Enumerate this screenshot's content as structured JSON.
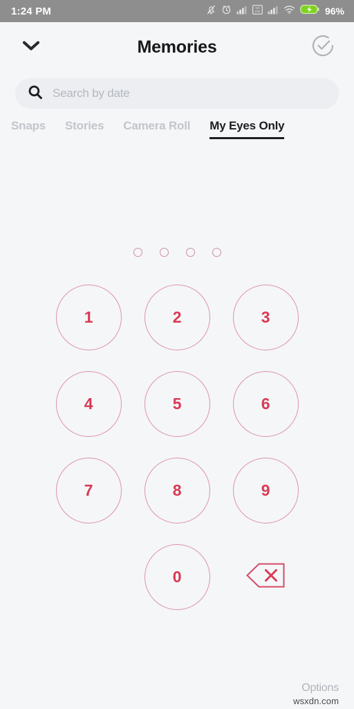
{
  "statusbar": {
    "time": "1:24 PM",
    "battery_percent": "96%",
    "icons": [
      "bell-mute-icon",
      "alarm-clock-icon",
      "signal-bars-icon",
      "volte-icon",
      "signal-bars-2-icon",
      "wifi-icon",
      "battery-charging-icon"
    ],
    "bg_color": "#8e8e8e",
    "battery_color": "#7ed321"
  },
  "header": {
    "title": "Memories",
    "back_icon": "chevron-down-icon",
    "action_icon": "check-circle-icon"
  },
  "search": {
    "placeholder": "Search by date",
    "value": "",
    "icon": "search-icon"
  },
  "tabs": [
    {
      "label": "Snaps",
      "active": false
    },
    {
      "label": "Stories",
      "active": false
    },
    {
      "label": "Camera Roll",
      "active": false
    },
    {
      "label": "My Eyes Only",
      "active": true
    }
  ],
  "pin": {
    "length": 4,
    "entered": 0,
    "dots": [
      "",
      "",
      "",
      ""
    ],
    "accent_color": "#d93a55",
    "dot_outline_color": "#cf8fa1"
  },
  "keypad": {
    "rows": [
      [
        "1",
        "2",
        "3"
      ],
      [
        "4",
        "5",
        "6"
      ],
      [
        "7",
        "8",
        "9"
      ]
    ],
    "zero": "0",
    "backspace_icon": "backspace-delete-icon",
    "key_border_color": "#dd93a8",
    "key_text_color": "#d93a55"
  },
  "footer": {
    "options_label": "Options",
    "watermark": "wsxdn.com"
  },
  "theme": {
    "background": "#f5f6f8",
    "title_color": "#18181a",
    "tab_inactive_color": "#c2c5cb"
  }
}
